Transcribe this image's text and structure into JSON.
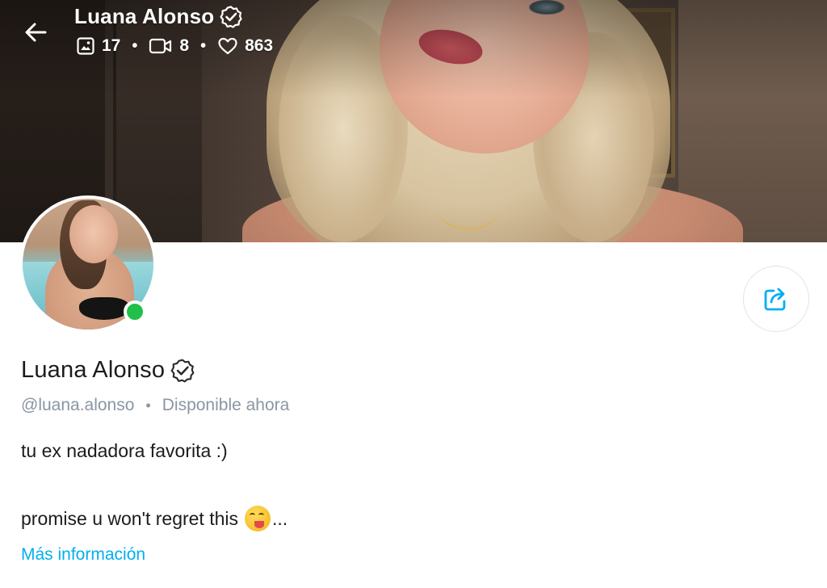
{
  "header": {
    "name": "Luana Alonso",
    "stats": {
      "photos": "17",
      "videos": "8",
      "likes": "863"
    },
    "icons": {
      "back": "arrow-left-icon",
      "verified": "verified-badge-icon",
      "photos": "image-icon",
      "videos": "video-camera-icon",
      "likes": "heart-icon"
    }
  },
  "profile": {
    "name": "Luana Alonso",
    "handle": "@luana.alonso",
    "status": "Disponible ahora",
    "online": true,
    "bio_line1": "tu ex nadadora favorita :)",
    "bio_line2": "promise u won't regret this",
    "bio_ellipsis": "...",
    "more_info": "Más información",
    "share_icon": "share-icon"
  },
  "colors": {
    "accent": "#00aff0",
    "online": "#20c04a",
    "muted": "#8a96a3",
    "text": "#1c1c1c"
  }
}
